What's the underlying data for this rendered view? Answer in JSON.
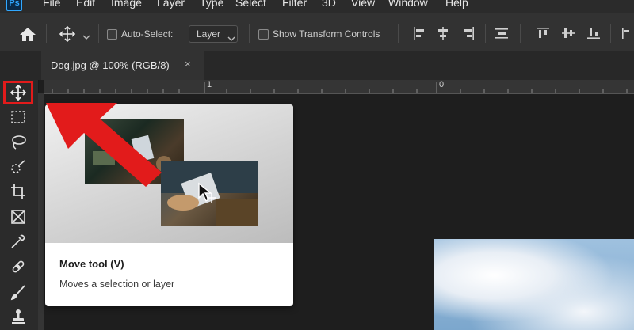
{
  "app": {
    "logo_text": "Ps"
  },
  "menubar": {
    "items": [
      "File",
      "Edit",
      "Image",
      "Layer",
      "Type",
      "Select",
      "Filter",
      "3D",
      "View",
      "Window",
      "Help"
    ]
  },
  "options": {
    "auto_select_label": "Auto-Select:",
    "layer_value": "Layer",
    "show_transform_label": "Show Transform Controls"
  },
  "document": {
    "tab_title": "Dog.jpg @ 100% (RGB/8)",
    "close_glyph": "×"
  },
  "ruler": {
    "labels": [
      "1",
      "0"
    ]
  },
  "tooltip": {
    "title": "Move tool (V)",
    "description": "Moves a selection or layer"
  },
  "colors": {
    "highlight_red": "#e21b1b",
    "panel": "#323232",
    "canvas": "#1e1e1e"
  }
}
